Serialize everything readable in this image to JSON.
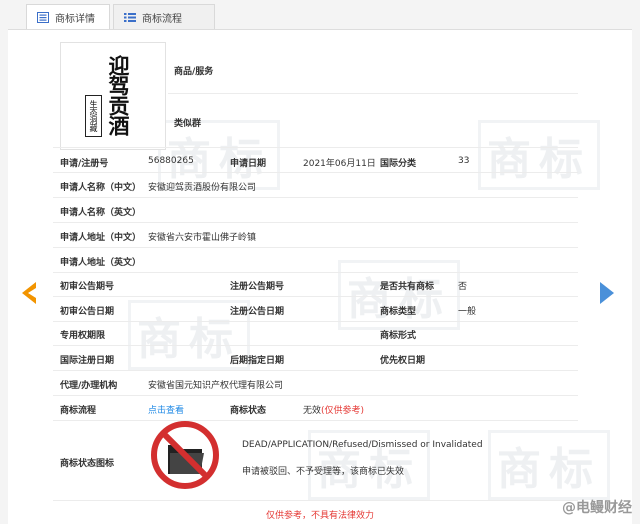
{
  "tabs": [
    {
      "label": "商标详情",
      "icon": "document-list-icon"
    },
    {
      "label": "商标流程",
      "icon": "flow-list-icon"
    }
  ],
  "logo": {
    "text": "迎驾贡酒",
    "seal": "生态洞藏"
  },
  "goods": {
    "label": "商品/服务",
    "value": ""
  },
  "similar_group": {
    "label": "类似群",
    "value": ""
  },
  "fields": {
    "reg_no_label": "申请/注册号",
    "reg_no": "56880265",
    "apply_date_label": "申请日期",
    "apply_date": "2021年06月11日",
    "intl_class_label": "国际分类",
    "intl_class": "33",
    "applicant_cn_label": "申请人名称（中文）",
    "applicant_cn": "安徽迎驾贡酒股份有限公司",
    "applicant_en_label": "申请人名称（英文）",
    "applicant_en": "",
    "addr_cn_label": "申请人地址（中文）",
    "addr_cn": "安徽省六安市霍山佛子岭镇",
    "addr_en_label": "申请人地址（英文）",
    "addr_en": "",
    "prelim_no_label": "初审公告期号",
    "prelim_no": "",
    "reg_pub_no_label": "注册公告期号",
    "reg_pub_no": "",
    "shared_label": "是否共有商标",
    "shared": "否",
    "prelim_date_label": "初审公告日期",
    "prelim_date": "",
    "reg_pub_date_label": "注册公告日期",
    "reg_pub_date": "",
    "type_label": "商标类型",
    "type": "一般",
    "exclusive_label": "专用权期限",
    "exclusive": "",
    "form_label": "商标形式",
    "form": "",
    "intl_reg_date_label": "国际注册日期",
    "intl_reg_date": "",
    "later_date_label": "后期指定日期",
    "later_date": "",
    "priority_label": "优先权日期",
    "priority": "",
    "agent_label": "代理/办理机构",
    "agent": "安徽省国元知识产权代理有限公司",
    "flow_label": "商标流程",
    "flow_link": "点击查看",
    "status_label": "商标状态",
    "status": "无效",
    "status_note": "(仅供参考)",
    "status_icon_label": "商标状态图标",
    "status_en": "DEAD/APPLICATION/Refused/Dismissed or Invalidated",
    "status_cn": "申请被驳回、不予受理等，该商标已失效"
  },
  "footer_note": "仅供参考，不具有法律效力",
  "watermark": "商标",
  "brand": "@电鳗财经",
  "colors": {
    "link": "#1e88e5",
    "red": "#e53935",
    "arrow_left": "#f29400",
    "arrow_right": "#4a90d9"
  }
}
